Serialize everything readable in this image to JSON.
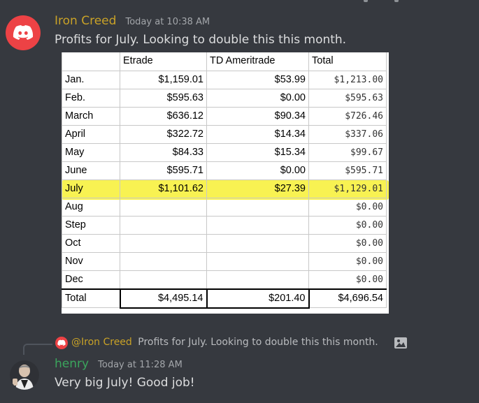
{
  "message1": {
    "author": "Iron Creed",
    "timestamp": "Today at 10:38 AM",
    "text": "Profits for July. Looking to double this this month.",
    "avatar_icon": "discord-logo-icon",
    "author_color": "#c9a227"
  },
  "sheet": {
    "headers": [
      "",
      "Etrade",
      "TD Ameritrade",
      "Total"
    ],
    "rows": [
      [
        "Jan.",
        "$1,159.01",
        "$53.99",
        "$1,213.00"
      ],
      [
        "Feb.",
        "$595.63",
        "$0.00",
        "$595.63"
      ],
      [
        "March",
        "$636.12",
        "$90.34",
        "$726.46"
      ],
      [
        "April",
        "$322.72",
        "$14.34",
        "$337.06"
      ],
      [
        "May",
        "$84.33",
        "$15.34",
        "$99.67"
      ],
      [
        "June",
        "$595.71",
        "$0.00",
        "$595.71"
      ],
      [
        "July",
        "$1,101.62",
        "$27.39",
        "$1,129.01"
      ],
      [
        "Aug",
        "",
        "",
        "$0.00"
      ],
      [
        "Step",
        "",
        "",
        "$0.00"
      ],
      [
        "Oct",
        "",
        "",
        "$0.00"
      ],
      [
        "Nov",
        "",
        "",
        "$0.00"
      ],
      [
        "Dec",
        "",
        "",
        "$0.00"
      ]
    ],
    "total": [
      "Total",
      "$4,495.14",
      "$201.40",
      "$4,696.54"
    ],
    "highlight_row": "July",
    "highlight_color": "#f6ee21"
  },
  "reply": {
    "mention": "@Iron Creed",
    "text": "Profits for July. Looking to double this this month.",
    "avatar_icon": "discord-logo-icon",
    "attachment_icon": "image-icon"
  },
  "message2": {
    "author": "henry",
    "timestamp": "Today at 11:28 AM",
    "text": "Very big July! Good job!",
    "author_color": "#3ba55d"
  }
}
